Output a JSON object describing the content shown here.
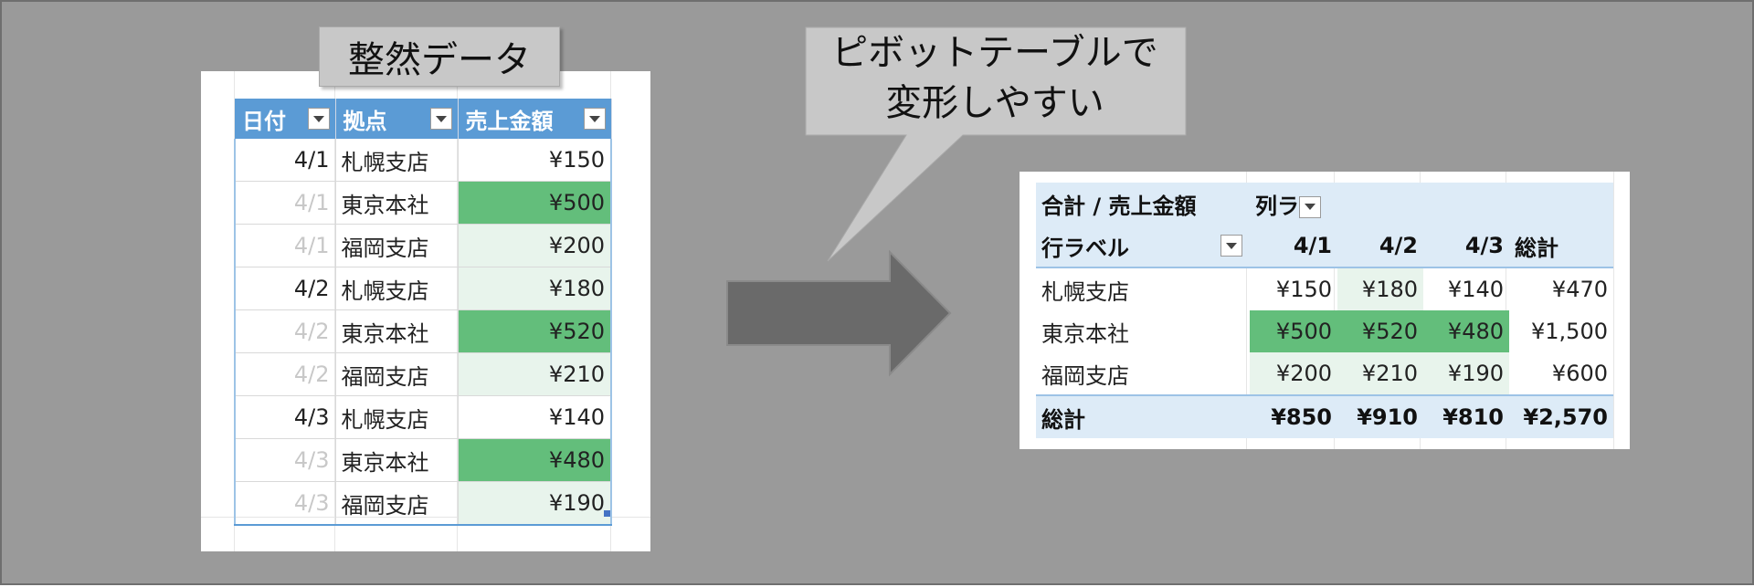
{
  "callout_left": "整然データ",
  "callout_right": {
    "line1": "ピボットテーブルで",
    "line2": "変形しやすい"
  },
  "source_table": {
    "headers": [
      "日付",
      "拠点",
      "売上金額"
    ],
    "rows": [
      {
        "date": "4/1",
        "branch": "札幌支店",
        "amount": "¥150",
        "date_dim": false,
        "level": "none"
      },
      {
        "date": "4/1",
        "branch": "東京本社",
        "amount": "¥500",
        "date_dim": true,
        "level": "high"
      },
      {
        "date": "4/1",
        "branch": "福岡支店",
        "amount": "¥200",
        "date_dim": true,
        "level": "low"
      },
      {
        "date": "4/2",
        "branch": "札幌支店",
        "amount": "¥180",
        "date_dim": false,
        "level": "low"
      },
      {
        "date": "4/2",
        "branch": "東京本社",
        "amount": "¥520",
        "date_dim": true,
        "level": "high"
      },
      {
        "date": "4/2",
        "branch": "福岡支店",
        "amount": "¥210",
        "date_dim": true,
        "level": "low"
      },
      {
        "date": "4/3",
        "branch": "札幌支店",
        "amount": "¥140",
        "date_dim": false,
        "level": "none"
      },
      {
        "date": "4/3",
        "branch": "東京本社",
        "amount": "¥480",
        "date_dim": true,
        "level": "high"
      },
      {
        "date": "4/3",
        "branch": "福岡支店",
        "amount": "¥190",
        "date_dim": true,
        "level": "low"
      }
    ]
  },
  "pivot": {
    "value_field": "合計 / 売上金額",
    "column_labels": "列ラ",
    "row_labels": "行ラベル",
    "columns": [
      "4/1",
      "4/2",
      "4/3",
      "総計"
    ],
    "rows": [
      {
        "label": "札幌支店",
        "values": [
          "¥150",
          "¥180",
          "¥140",
          "¥470"
        ],
        "levels": [
          "none",
          "lo",
          "none",
          "none"
        ]
      },
      {
        "label": "東京本社",
        "values": [
          "¥500",
          "¥520",
          "¥480",
          "¥1,500"
        ],
        "levels": [
          "hi",
          "hi",
          "hi",
          "none"
        ]
      },
      {
        "label": "福岡支店",
        "values": [
          "¥200",
          "¥210",
          "¥190",
          "¥600"
        ],
        "levels": [
          "lo",
          "lo",
          "lo",
          "none"
        ]
      }
    ],
    "total": {
      "label": "総計",
      "values": [
        "¥850",
        "¥910",
        "¥810",
        "¥2,570"
      ]
    }
  },
  "colors": {
    "background": "#9a9a9a",
    "header_blue": "#5b9bd5",
    "highlight_green": "#63be7b",
    "light_green": "#e8f4ec",
    "pivot_header": "#ddebf7",
    "arrow": "#6a6a6a"
  }
}
